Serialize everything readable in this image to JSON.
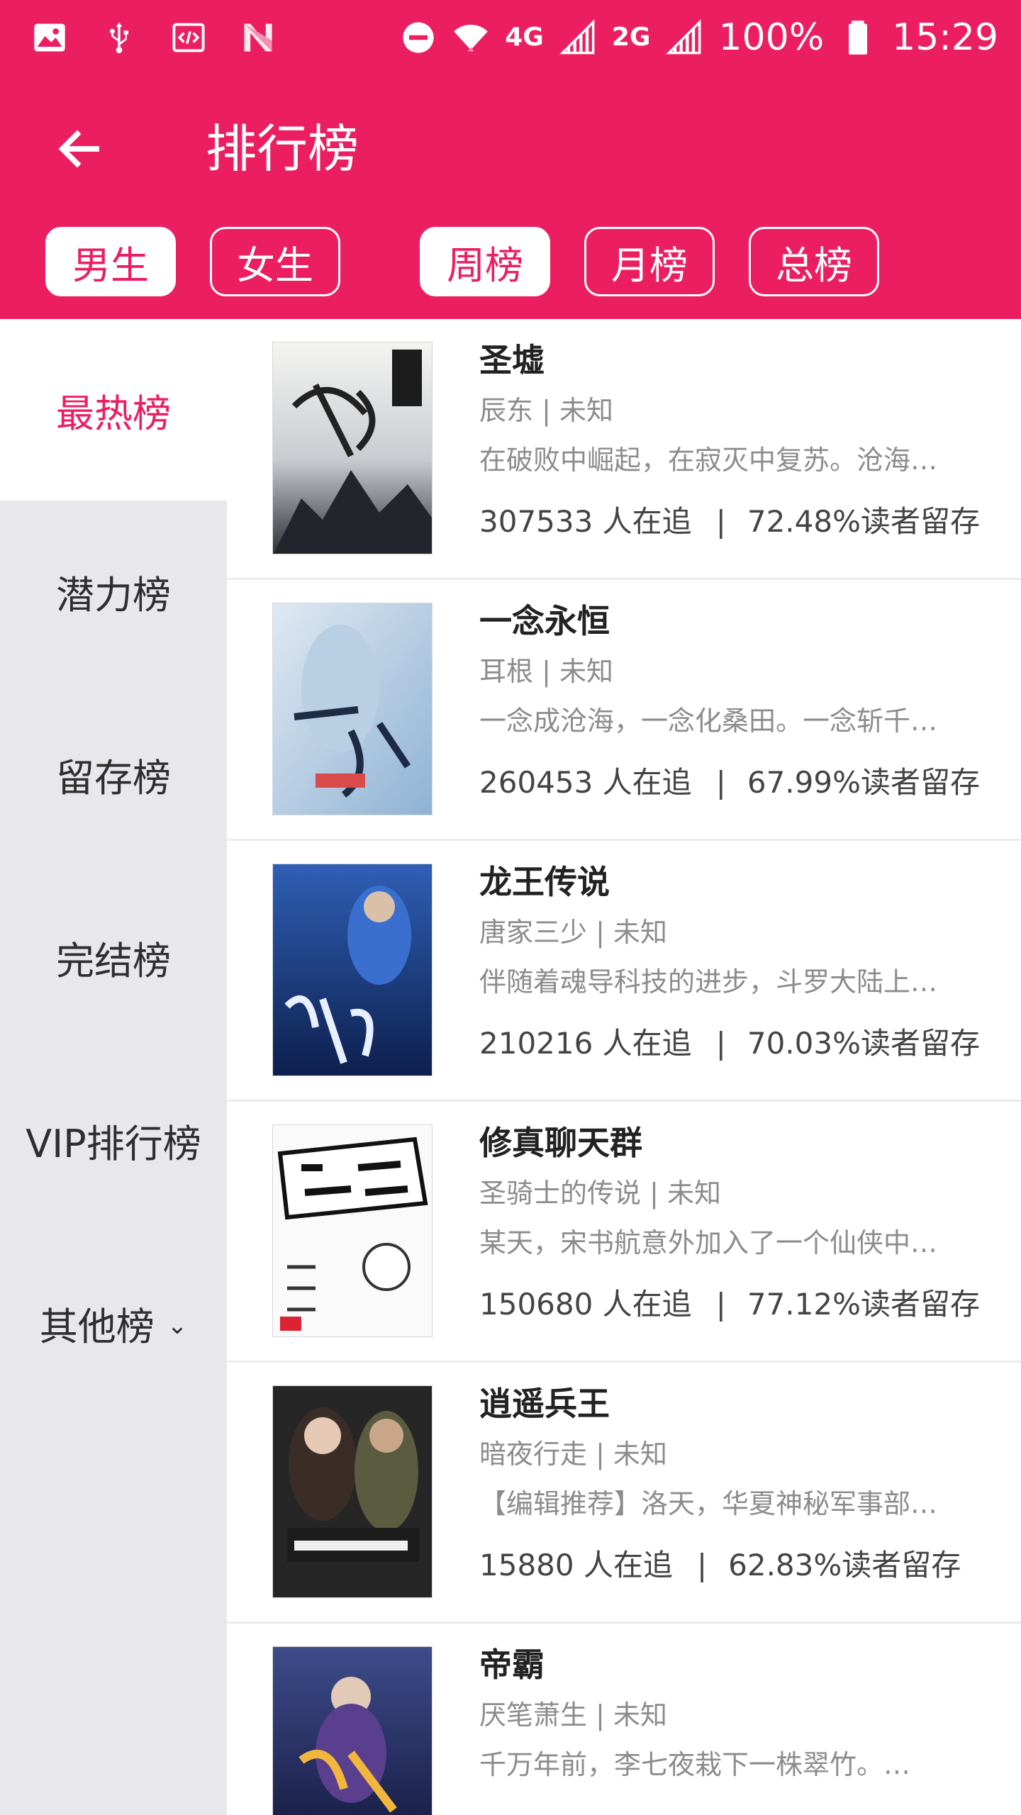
{
  "status_bar": {
    "left_icons": [
      "image-icon",
      "usb-icon",
      "code-icon",
      "n-icon"
    ],
    "right_icons": [
      "do-not-disturb-icon",
      "wifi-icon",
      "lte-signal-icon"
    ],
    "network_4g": "4G",
    "network_2g": "2G",
    "battery": "100%",
    "time": "15:29"
  },
  "header": {
    "title": "排行榜"
  },
  "filters": {
    "gender": [
      {
        "label": "男生",
        "active": true
      },
      {
        "label": "女生",
        "active": false
      }
    ],
    "period": [
      {
        "label": "周榜",
        "active": true
      },
      {
        "label": "月榜",
        "active": false
      },
      {
        "label": "总榜",
        "active": false
      }
    ]
  },
  "sidebar": {
    "items": [
      {
        "label": "最热榜",
        "active": true
      },
      {
        "label": "潜力榜",
        "active": false
      },
      {
        "label": "留存榜",
        "active": false
      },
      {
        "label": "完结榜",
        "active": false
      },
      {
        "label": "VIP排行榜",
        "active": false
      },
      {
        "label": "其他榜",
        "active": false
      }
    ],
    "more_icon": "chevron-down-icon"
  },
  "books": [
    {
      "title": "圣墟",
      "author": "辰东 | 未知",
      "desc": "在破败中崛起，在寂灭中复苏。沧海…",
      "followers": "307533 人在追",
      "retention": "72.48%读者留存"
    },
    {
      "title": "一念永恒",
      "author": "耳根 | 未知",
      "desc": "一念成沧海，一念化桑田。一念斩千…",
      "followers": "260453 人在追",
      "retention": "67.99%读者留存"
    },
    {
      "title": "龙王传说",
      "author": "唐家三少 | 未知",
      "desc": "伴随着魂导科技的进步，斗罗大陆上…",
      "followers": "210216 人在追",
      "retention": "70.03%读者留存"
    },
    {
      "title": "修真聊天群",
      "author": "圣骑士的传说 | 未知",
      "desc": "某天，宋书航意外加入了一个仙侠中…",
      "followers": "150680 人在追",
      "retention": "77.12%读者留存"
    },
    {
      "title": "逍遥兵王",
      "author": "暗夜行走 | 未知",
      "desc": "【编辑推荐】洛天，华夏神秘军事部…",
      "followers": "15880 人在追",
      "retention": "62.83%读者留存"
    },
    {
      "title": "帝霸",
      "author": "厌笔萧生 | 未知",
      "desc": "千万年前，李七夜栽下一株翠竹。…",
      "followers": "",
      "retention": ""
    }
  ],
  "separator": "|",
  "colors": {
    "accent": "#ec1e62",
    "sidebar_bg": "#e8e7ec",
    "muted_text": "#8c8c8c"
  }
}
